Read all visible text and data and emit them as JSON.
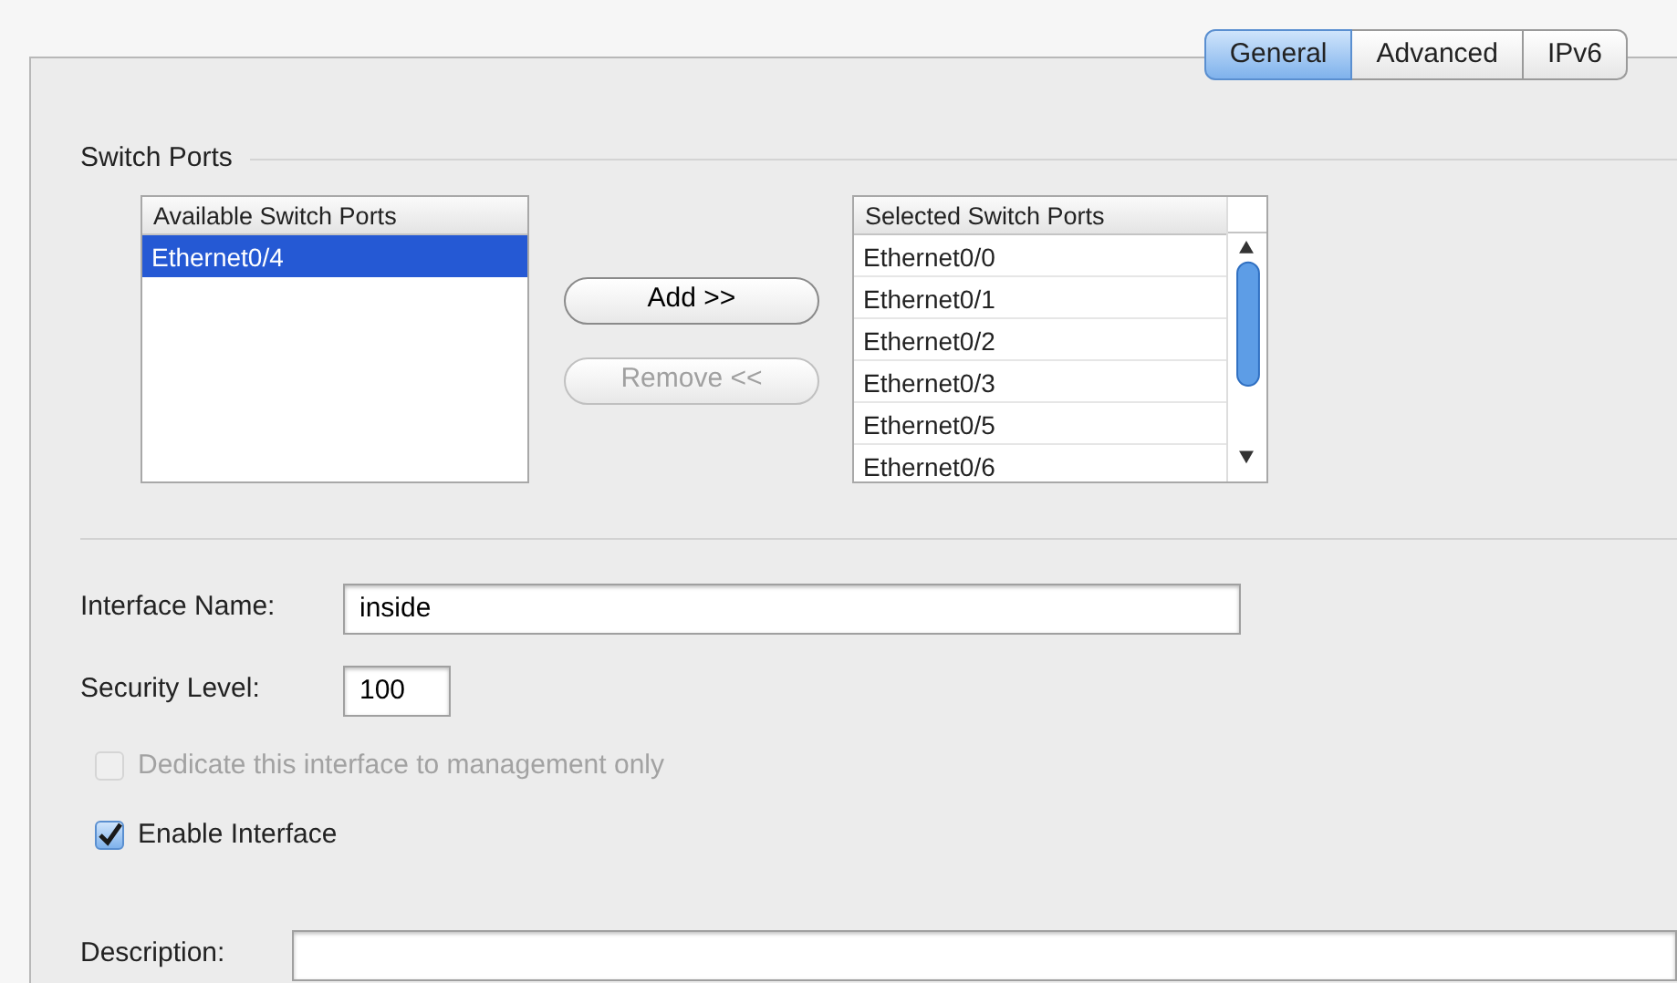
{
  "tabs": [
    {
      "label": "General",
      "selected": true
    },
    {
      "label": "Advanced",
      "selected": false
    },
    {
      "label": "IPv6",
      "selected": false
    }
  ],
  "switch_ports": {
    "title": "Switch Ports",
    "available": {
      "header": "Available Switch Ports",
      "items": [
        {
          "label": "Ethernet0/4",
          "selected": true
        }
      ]
    },
    "buttons": [
      {
        "label": "Add >>",
        "disabled": false
      },
      {
        "label": "Remove <<",
        "disabled": true
      }
    ],
    "selected": {
      "header": "Selected Switch Ports",
      "items": [
        {
          "label": "Ethernet0/0",
          "selected": false
        },
        {
          "label": "Ethernet0/1",
          "selected": false
        },
        {
          "label": "Ethernet0/2",
          "selected": false
        },
        {
          "label": "Ethernet0/3",
          "selected": false
        },
        {
          "label": "Ethernet0/5",
          "selected": false
        },
        {
          "label": "Ethernet0/6",
          "selected": false
        }
      ]
    }
  },
  "fields": [
    {
      "label": "Interface Name:",
      "value": "inside"
    },
    {
      "label": "Security Level:",
      "value": "100"
    }
  ],
  "checkboxes": [
    {
      "label": "Dedicate this interface to management only",
      "checked": false,
      "disabled": true
    },
    {
      "label": "Enable Interface",
      "checked": true,
      "disabled": false
    }
  ],
  "description": {
    "label": "Description:"
  }
}
